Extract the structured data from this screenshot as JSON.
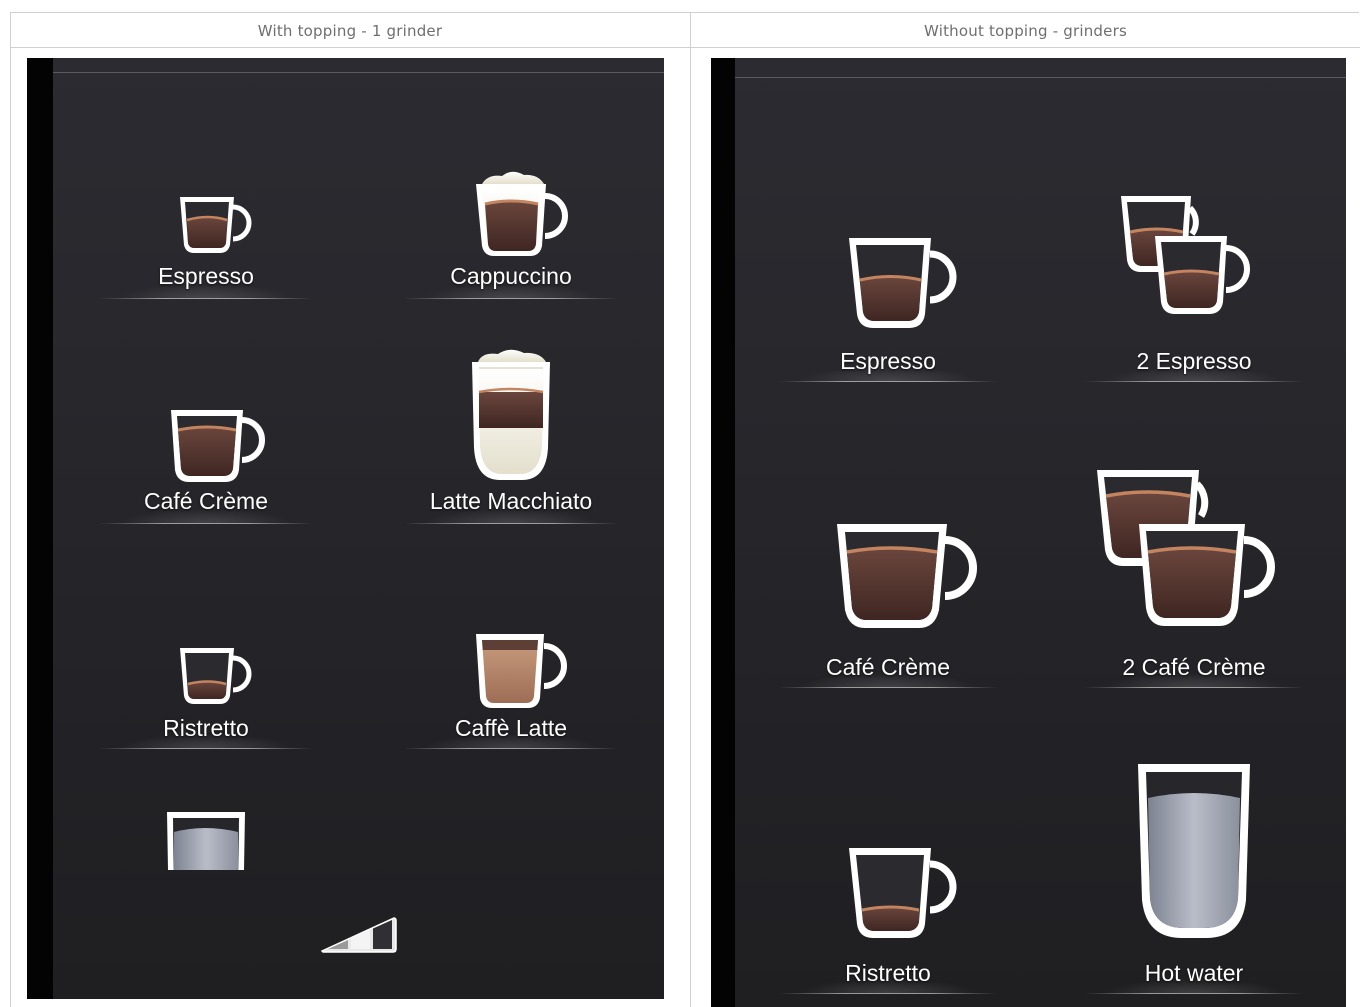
{
  "columns": [
    {
      "header": "With topping - 1 grinder",
      "items": [
        {
          "label": "Espresso",
          "icon": "espresso-cup-icon"
        },
        {
          "label": "Cappuccino",
          "icon": "cappuccino-cup-icon"
        },
        {
          "label": "Café Crème",
          "icon": "cafe-creme-cup-icon"
        },
        {
          "label": "Latte Macchiato",
          "icon": "latte-macchiato-glass-icon"
        },
        {
          "label": "Ristretto",
          "icon": "ristretto-cup-icon"
        },
        {
          "label": "Caffè Latte",
          "icon": "caffe-latte-cup-icon"
        },
        {
          "label": "",
          "icon": "hot-water-glass-icon"
        }
      ],
      "footer_icon": "volume-level-icon"
    },
    {
      "header": "Without topping - grinders",
      "items": [
        {
          "label": "Espresso",
          "icon": "espresso-cup-icon"
        },
        {
          "label": "2 Espresso",
          "icon": "double-espresso-cup-icon"
        },
        {
          "label": "Café Crème",
          "icon": "cafe-creme-cup-icon"
        },
        {
          "label": "2 Café Crème",
          "icon": "double-cafe-creme-cup-icon"
        },
        {
          "label": "Ristretto",
          "icon": "ristretto-cup-icon"
        },
        {
          "label": "Hot water",
          "icon": "hot-water-glass-icon"
        }
      ]
    }
  ],
  "colors": {
    "screen_bg": "#27272c",
    "coffee": "#5a3a33",
    "crema": "#b8795c",
    "milk_foam": "#f2efe2",
    "latte": "#b88a6e",
    "water": "#9aa0ad"
  }
}
